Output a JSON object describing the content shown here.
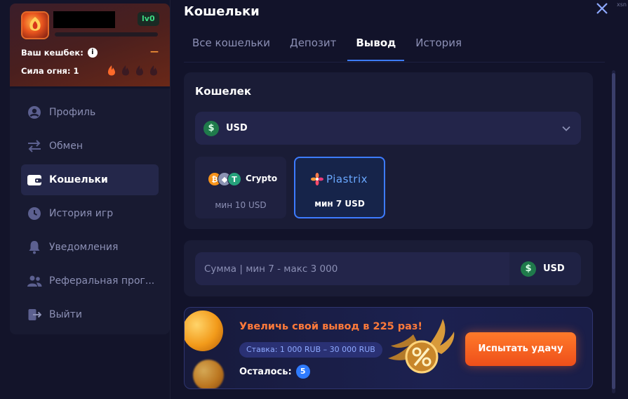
{
  "profile": {
    "level": "lv0",
    "cashback_label": "Ваш кешбек:",
    "cashback_value": "—",
    "fire_label": "Сила огня: 1"
  },
  "menu": {
    "items": [
      {
        "label": "Профиль",
        "icon": "user-icon"
      },
      {
        "label": "Обмен",
        "icon": "exchange-icon"
      },
      {
        "label": "Кошельки",
        "icon": "wallet-icon"
      },
      {
        "label": "История игр",
        "icon": "clock-icon"
      },
      {
        "label": "Уведомления",
        "icon": "bell-icon"
      },
      {
        "label": "Реферальная прог...",
        "icon": "users-icon"
      },
      {
        "label": "Выйти",
        "icon": "logout-icon"
      }
    ]
  },
  "header": {
    "title": "Кошельки",
    "edge_text": "xsn"
  },
  "tabs": [
    {
      "label": "Все кошельки"
    },
    {
      "label": "Депозит"
    },
    {
      "label": "Вывод"
    },
    {
      "label": "История"
    }
  ],
  "wallet": {
    "title": "Кошелек",
    "currency_icon": "$",
    "currency": "USD"
  },
  "methods": {
    "crypto": {
      "name": "Crypto",
      "min": "мин 10 USD"
    },
    "piastrix": {
      "name": "Piastrix",
      "min": "мин 7 USD"
    }
  },
  "amount": {
    "placeholder": "Сумма | мин 7 - макс 3 000",
    "currency_icon": "$",
    "currency": "USD"
  },
  "promo": {
    "title": "Увеличь свой вывод в 225 раз!",
    "rate": "Ставка: 1 000 RUB – 30 000 RUB",
    "left_label": "Осталось:",
    "left_count": "5",
    "button": "Испытать удачу"
  },
  "colors": {
    "accent_blue": "#3d7bff",
    "promo_orange": "#ff7a3a",
    "level_green": "#3ddc84"
  }
}
